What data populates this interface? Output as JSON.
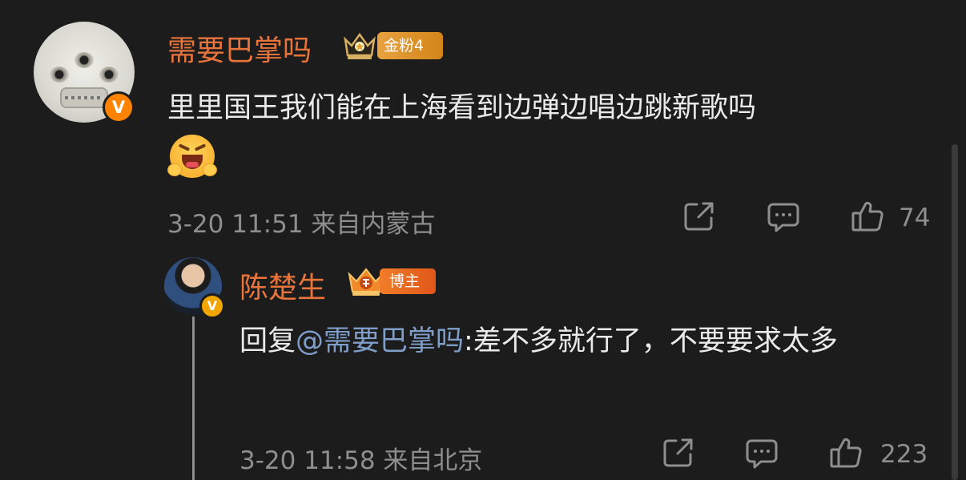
{
  "top_comment": {
    "username": "需要巴掌吗",
    "fan_badge": "金粉4",
    "text": "里里国王我们能在上海看到边弹边唱边跳新歌吗",
    "verified_mark": "V",
    "emoji": "scream-face-emoji",
    "timestamp": "3-20 11:51",
    "location": "来自内蒙古",
    "likes": "74",
    "icons": [
      "share-icon",
      "comment-icon",
      "like-icon"
    ]
  },
  "reply": {
    "username": "陈楚生",
    "role_badge": "博主",
    "prefix": "回复",
    "mention": "@需要巴掌吗",
    "text": ":差不多就行了，不要要求太多",
    "verified_mark": "V",
    "timestamp": "3-20 11:58",
    "location": "来自北京",
    "likes": "223",
    "icons": [
      "share-icon",
      "comment-icon",
      "like-icon"
    ]
  },
  "colors": {
    "background": "#1c1c1d",
    "username": "#e8743b",
    "mention": "#7f9ec9",
    "meta": "#8e8e8e",
    "verified": "#ff8200"
  }
}
